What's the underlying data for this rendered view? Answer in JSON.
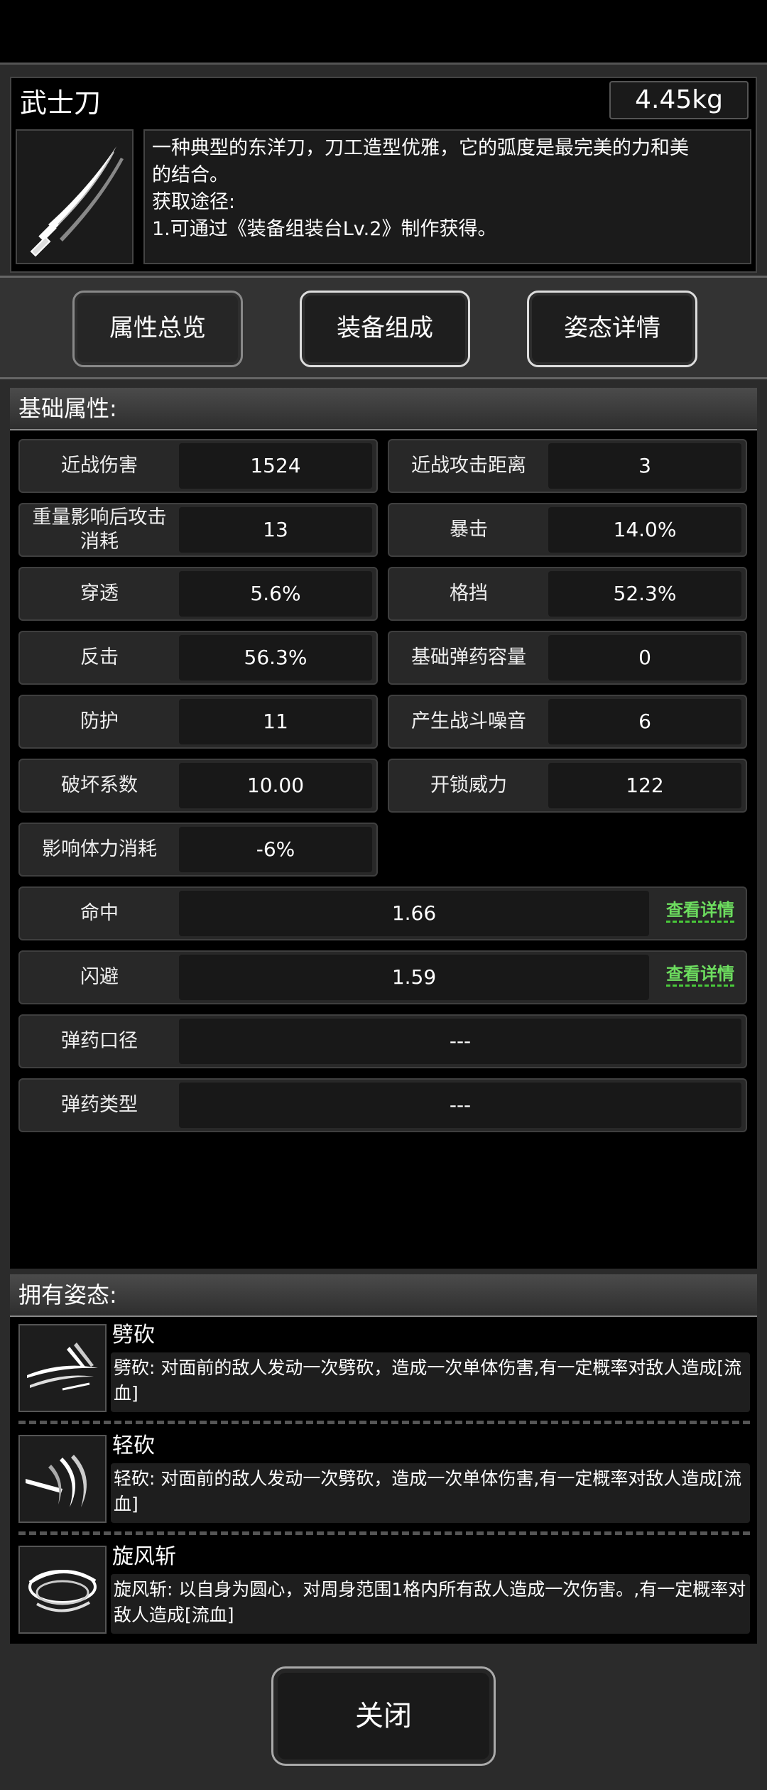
{
  "item": {
    "name": "武士刀",
    "weight": "4.45kg",
    "description_lines": [
      "一种典型的东洋刀，刀工造型优雅，它的弧度是最完美的力和美",
      "的结合。",
      "获取途径:",
      "1.可通过《装备组装台Lv.2》制作获得。"
    ]
  },
  "tabs": [
    {
      "label": "属性总览"
    },
    {
      "label": "装备组成"
    },
    {
      "label": "姿态详情"
    }
  ],
  "basic": {
    "title": "基础属性:",
    "pairs": [
      {
        "label": "近战伤害",
        "value": "1524"
      },
      {
        "label": "近战攻击距离",
        "value": "3"
      },
      {
        "label": "重量影响后攻击消耗",
        "value": "13"
      },
      {
        "label": "暴击",
        "value": "14.0%"
      },
      {
        "label": "穿透",
        "value": "5.6%"
      },
      {
        "label": "格挡",
        "value": "52.3%"
      },
      {
        "label": "反击",
        "value": "56.3%"
      },
      {
        "label": "基础弹药容量",
        "value": "0"
      },
      {
        "label": "防护",
        "value": "11"
      },
      {
        "label": "产生战斗噪音",
        "value": "6"
      },
      {
        "label": "破坏系数",
        "value": "10.00"
      },
      {
        "label": "开锁威力",
        "value": "122"
      },
      {
        "label": "影响体力消耗",
        "value": "-6%"
      }
    ],
    "wide": [
      {
        "label": "命中",
        "value": "1.66",
        "link": "查看详情"
      },
      {
        "label": "闪避",
        "value": "1.59",
        "link": "查看详情"
      },
      {
        "label": "弹药口径",
        "value": "---"
      },
      {
        "label": "弹药类型",
        "value": "---"
      }
    ]
  },
  "stances": {
    "title": "拥有姿态:",
    "items": [
      {
        "name": "劈砍",
        "desc": "劈砍: 对面前的敌人发动一次劈砍，造成一次单体伤害,有一定概率对敌人造成[流血]"
      },
      {
        "name": "轻砍",
        "desc": "轻砍: 对面前的敌人发动一次劈砍，造成一次单体伤害,有一定概率对敌人造成[流血]"
      },
      {
        "name": "旋风斩",
        "desc": "旋风斩: 以自身为圆心，对周身范围1格内所有敌人造成一次伤害。,有一定概率对敌人造成[流血]"
      }
    ]
  },
  "close_label": "关闭"
}
